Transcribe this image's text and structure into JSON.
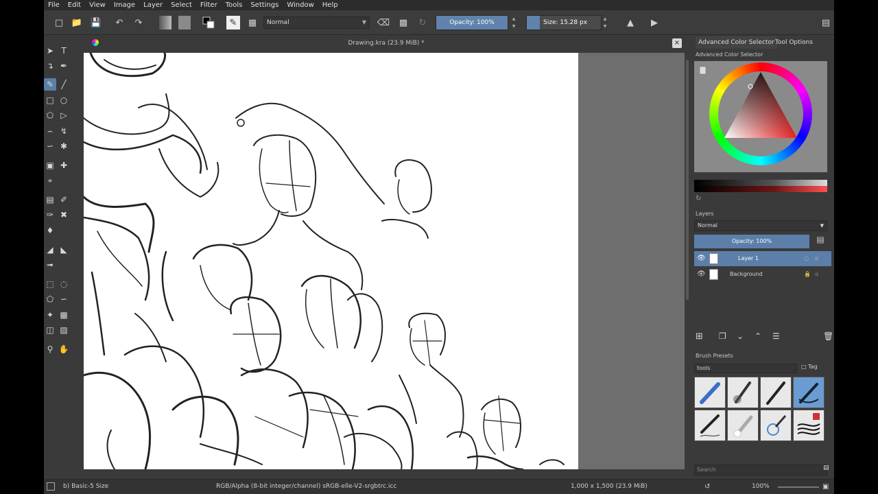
{
  "menu": [
    "File",
    "Edit",
    "View",
    "Image",
    "Layer",
    "Select",
    "Filter",
    "Tools",
    "Settings",
    "Window",
    "Help"
  ],
  "toolbar": {
    "blend_mode": "Normal",
    "opacity_label": "Opacity: 100%",
    "opacity_value": 1.0,
    "size_label": "Size: 15.28 px",
    "size_value": 0.18
  },
  "document": {
    "title": "Drawing.kra (23.9 MiB) *",
    "close_glyph": "×"
  },
  "docker": {
    "tab_color": "Advanced Color Selector",
    "tab_tool_options": "Tool Options",
    "color_panel_title": "Advanced Color Selector",
    "layers_title": "Layers",
    "layer_blend": "Normal",
    "layer_opacity_label": "Opacity:  100%",
    "layers": [
      {
        "name": "Layer 1",
        "selected": true
      },
      {
        "name": "Background",
        "selected": false
      }
    ],
    "brush_presets_title": "Brush Presets",
    "brush_tag": "tools",
    "brush_tag_btn": "Tag",
    "search_placeholder": "Search"
  },
  "status": {
    "brush": "b) Basic-5 Size",
    "color_profile": "RGB/Alpha (8-bit integer/channel)  sRGB-elle-V2-srgbtrc.icc",
    "dimensions": "1,000 x 1,500 (23.9 MiB)",
    "zoom": "100%"
  },
  "colors": {
    "accent": "#5b7fa8",
    "bg": "#3a3a3a",
    "menubar": "#2c2c2c"
  }
}
